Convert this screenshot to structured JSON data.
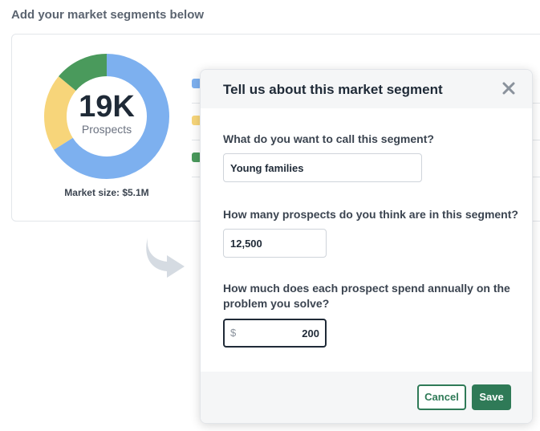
{
  "page": {
    "heading": "Add your market segments below"
  },
  "segments_card": {
    "donut": {
      "value": "19K",
      "label": "Prospects",
      "market_size": "Market size: $5.1M",
      "segments": [
        {
          "color": "#7db0ef",
          "fraction": 0.66
        },
        {
          "color": "#f7d57a",
          "fraction": 0.2
        },
        {
          "color": "#4a9a5c",
          "fraction": 0.14
        }
      ]
    },
    "legend": [
      {
        "color": "#7db0ef"
      },
      {
        "color": "#f7d57a"
      },
      {
        "color": "#4a9a5c"
      }
    ]
  },
  "modal": {
    "title": "Tell us about this market segment",
    "fields": {
      "name": {
        "label": "What do you want to call this segment?",
        "value": "Young families"
      },
      "prospects": {
        "label": "How many prospects do you think are in this segment?",
        "value": "12,500"
      },
      "spend": {
        "label": "How much does each prospect spend annually on the problem you solve?",
        "currency": "$",
        "value": "200"
      }
    },
    "cancel_label": "Cancel",
    "save_label": "Save"
  },
  "colors": {
    "accent": "#2f7a57",
    "arrow": "#d5dbe2"
  },
  "icons": [
    "close-icon",
    "curved-arrow-icon"
  ]
}
